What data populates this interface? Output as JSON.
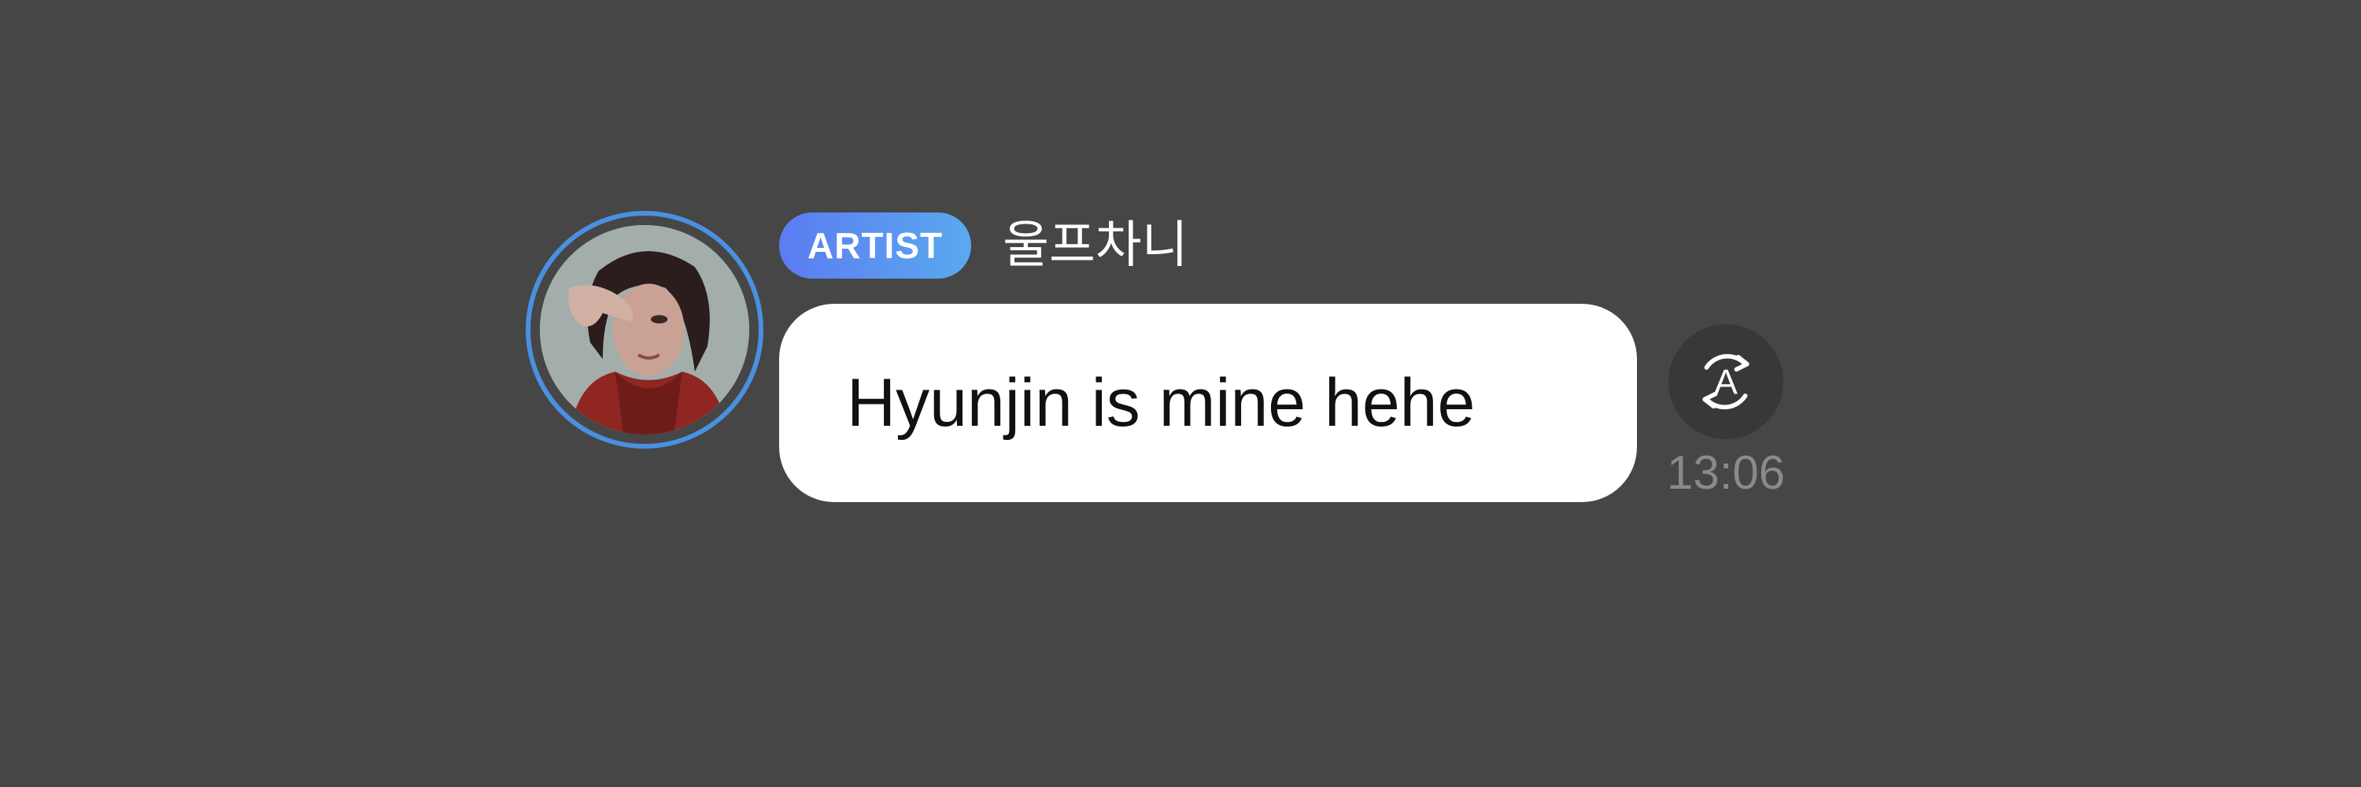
{
  "message": {
    "badge": "ARTIST",
    "username": "울프차니",
    "text": "Hyunjin is mine hehe",
    "time": "13:06"
  },
  "icons": {
    "avatar": "profile-photo",
    "translate": "translate-icon",
    "translate_glyph": "A"
  },
  "colors": {
    "background": "#464646",
    "badge_gradient_start": "#5c7cf2",
    "badge_gradient_end": "#5aa9ef",
    "avatar_ring": "#4a90e2",
    "bubble": "#ffffff",
    "timestamp": "#8a8a8a"
  }
}
